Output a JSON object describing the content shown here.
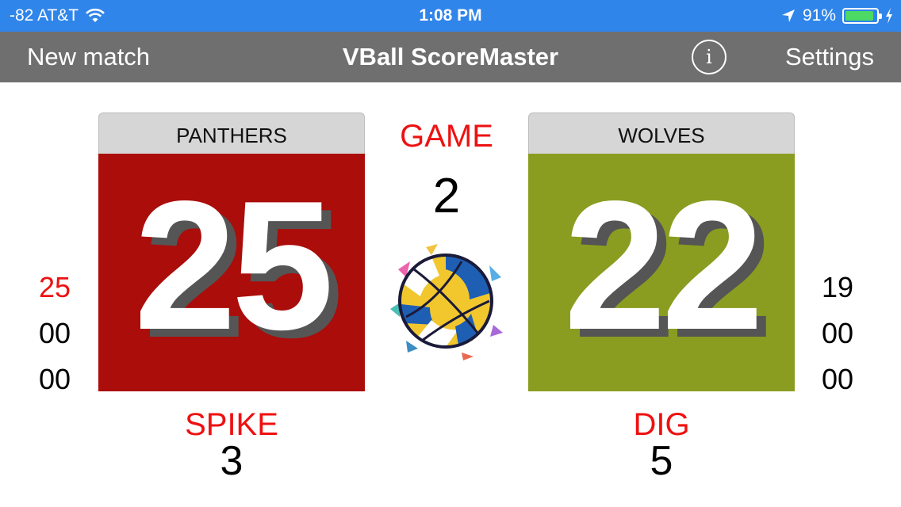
{
  "status_bar": {
    "carrier": "-82 AT&T",
    "time": "1:08 PM",
    "battery": "91%",
    "battery_level": 0.91
  },
  "nav": {
    "new_match": "New match",
    "title": "VBall ScoreMaster",
    "info": "i",
    "settings": "Settings"
  },
  "home": {
    "name": "PANTHERS",
    "score": "25",
    "color": "#aa0d0a",
    "sets": [
      "25",
      "00",
      "00"
    ],
    "stat_label": "SPIKE",
    "stat_value": "3"
  },
  "away": {
    "name": "WOLVES",
    "score": "22",
    "color": "#8a9d20",
    "sets": [
      "19",
      "00",
      "00"
    ],
    "stat_label": "DIG",
    "stat_value": "5"
  },
  "game": {
    "label": "GAME",
    "number": "2"
  },
  "icons": {
    "wifi": "wifi-icon",
    "location": "location-arrow-icon",
    "charging": "bolt-icon",
    "info": "info-icon",
    "ball": "volleyball-icon"
  }
}
